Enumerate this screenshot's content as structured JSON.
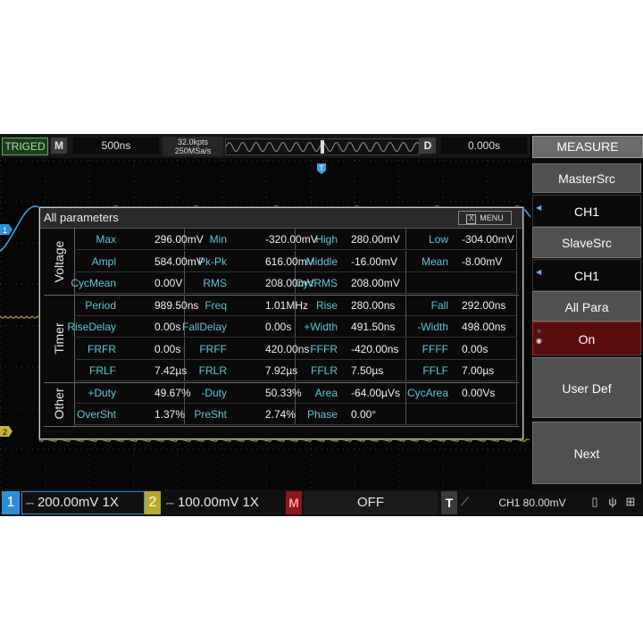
{
  "topbar": {
    "status": "TRIGED",
    "mode": "M",
    "timebase": "500ns",
    "memory_depth": "32.0kpts",
    "sample_rate": "250MSa/s",
    "delay_label": "D",
    "delay": "0.000s"
  },
  "menu": {
    "title": "MEASURE",
    "items": [
      {
        "label": "MasterSrc",
        "value": "CH1"
      },
      {
        "label": "SlaveSrc",
        "value": "CH1"
      },
      {
        "label": "All Para",
        "value": "On"
      },
      {
        "label": "User Def"
      },
      {
        "label": "Next"
      }
    ]
  },
  "dialog": {
    "title": "All parameters",
    "menu_label": "MENU",
    "close_glyph": "X",
    "sections": [
      {
        "name": "Voltage",
        "rows": [
          [
            {
              "k": "Max",
              "v": "296.00mV"
            },
            {
              "k": "Min",
              "v": "-320.00mV"
            },
            {
              "k": "High",
              "v": "280.00mV"
            },
            {
              "k": "Low",
              "v": "-304.00mV"
            }
          ],
          [
            {
              "k": "Ampl",
              "v": "584.00mV"
            },
            {
              "k": "Pk-Pk",
              "v": "616.00mV"
            },
            {
              "k": "Middle",
              "v": "-16.00mV"
            },
            {
              "k": "Mean",
              "v": "-8.00mV"
            }
          ],
          [
            {
              "k": "CycMean",
              "v": "0.00V"
            },
            {
              "k": "RMS",
              "v": "208.00mV"
            },
            {
              "k": "CycRMS",
              "v": "208.00mV"
            },
            {
              "k": "",
              "v": ""
            }
          ]
        ]
      },
      {
        "name": "Timer",
        "rows": [
          [
            {
              "k": "Period",
              "v": "989.50ns"
            },
            {
              "k": "Freq",
              "v": "1.01MHz"
            },
            {
              "k": "Rise",
              "v": "280.00ns"
            },
            {
              "k": "Fall",
              "v": "292.00ns"
            }
          ],
          [
            {
              "k": "RiseDelay",
              "v": "0.00s"
            },
            {
              "k": "FallDelay",
              "v": "0.00s"
            },
            {
              "k": "+Width",
              "v": "491.50ns"
            },
            {
              "k": "-Width",
              "v": "498.00ns"
            }
          ],
          [
            {
              "k": "FRFR",
              "v": "0.00s"
            },
            {
              "k": "FRFF",
              "v": "420.00ns"
            },
            {
              "k": "FFFR",
              "v": "-420.00ns"
            },
            {
              "k": "FFFF",
              "v": "0.00s"
            }
          ],
          [
            {
              "k": "FRLF",
              "v": "7.42µs"
            },
            {
              "k": "FRLR",
              "v": "7.92µs"
            },
            {
              "k": "FFLR",
              "v": "7.50µs"
            },
            {
              "k": "FFLF",
              "v": "7.00µs"
            }
          ]
        ]
      },
      {
        "name": "Other",
        "rows": [
          [
            {
              "k": "+Duty",
              "v": "49.67%"
            },
            {
              "k": "-Duty",
              "v": "50.33%"
            },
            {
              "k": "Area",
              "v": "-64.00µVs"
            },
            {
              "k": "CycArea",
              "v": "0.00Vs"
            }
          ],
          [
            {
              "k": "OverSht",
              "v": "1.37%"
            },
            {
              "k": "PreSht",
              "v": "2.74%"
            },
            {
              "k": "Phase",
              "v": "0.00°"
            },
            {
              "k": "",
              "v": ""
            }
          ]
        ]
      }
    ]
  },
  "markers": {
    "ch1": "1",
    "ch2": "2",
    "trigger_pos": "T"
  },
  "bottombar": {
    "ch1_num": "1",
    "ch1_scale": "200.00mV",
    "ch1_probe": "1X",
    "ch2_num": "2",
    "ch2_scale": "100.00mV",
    "ch2_probe": "1X",
    "math_num": "M",
    "math_state": "OFF",
    "trigger_num": "T",
    "trigger_info": "CH1 80.00mV"
  },
  "colors": {
    "ch1": "#2b8fd6",
    "ch2": "#b8a82a",
    "math": "#8f1616",
    "param_key": "#5ec5d9",
    "active_menu": "#5a0d0d"
  },
  "icons": [
    "coupling-dc-icon",
    "rising-edge-icon",
    "usb-storage-icon",
    "usb-icon",
    "network-icon"
  ]
}
